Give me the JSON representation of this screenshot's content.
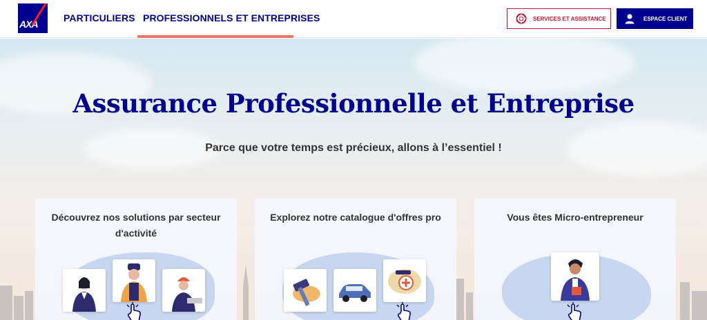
{
  "header": {
    "logo_text": "AXA",
    "nav": [
      {
        "label": "PARTICULIERS"
      },
      {
        "label": "PROFESSIONNELS ET ENTREPRISES",
        "active": true
      }
    ],
    "services_label": "SERVICES ET ASSISTANCE",
    "client_label": "ESPACE CLIENT"
  },
  "hero": {
    "title": "Assurance Professionnelle et Entreprise",
    "subtitle": "Parce que votre temps est précieux, allons à l’essentiel !"
  },
  "cards": [
    {
      "title": "Découvrez nos solutions par secteur d'activité",
      "icons": [
        "lawyer-icon",
        "chef-icon",
        "worker-icon"
      ]
    },
    {
      "title": "Explorez notre catalogue d'offres pro",
      "icons": [
        "hammer-icon",
        "car-icon",
        "health-icon"
      ]
    },
    {
      "title": "Vous êtes Micro-entrepreneur",
      "icons": [
        "entrepreneur-icon"
      ]
    }
  ],
  "colors": {
    "brand": "#00008f",
    "accent": "#f07662",
    "red": "#c91432"
  }
}
